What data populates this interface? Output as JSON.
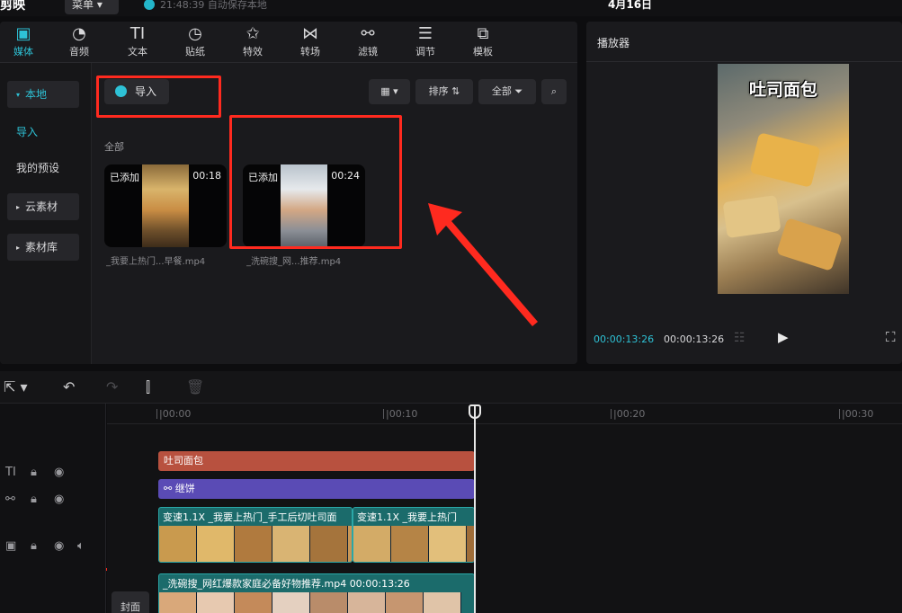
{
  "app": {
    "title": "剪映",
    "menu_label": "菜单",
    "save_status": "21:48:39 自动保存本地",
    "project_date": "4月16日"
  },
  "tabs": [
    {
      "label": "媒体",
      "icon": "media-icon",
      "glyph": "▣",
      "active": true
    },
    {
      "label": "音频",
      "icon": "audio-icon",
      "glyph": "◔"
    },
    {
      "label": "文本",
      "icon": "text-icon",
      "glyph": "TI"
    },
    {
      "label": "贴纸",
      "icon": "sticker-icon",
      "glyph": "◷"
    },
    {
      "label": "特效",
      "icon": "effects-icon",
      "glyph": "✩"
    },
    {
      "label": "转场",
      "icon": "transition-icon",
      "glyph": "⋈"
    },
    {
      "label": "滤镜",
      "icon": "filter-icon",
      "glyph": "⚯"
    },
    {
      "label": "调节",
      "icon": "adjust-icon",
      "glyph": "☰"
    },
    {
      "label": "模板",
      "icon": "template-icon",
      "glyph": "⧉"
    }
  ],
  "side_nav": {
    "local": "本地",
    "import": "导入",
    "my_presets": "我的预设",
    "cloud": "云素材",
    "library": "素材库"
  },
  "media": {
    "import_label": "导入",
    "sort_label": "排序",
    "filter_label": "全部",
    "section_label": "全部",
    "items": [
      {
        "added": "已添加",
        "duration": "00:18",
        "name": "_我要上热门...早餐.mp4"
      },
      {
        "added": "已添加",
        "duration": "00:24",
        "name": "_洗碗搜_网...推荐.mp4"
      }
    ]
  },
  "player": {
    "title": "播放器",
    "caption": "吐司面包",
    "time_current": "00:00:13:26",
    "time_total": "00:00:13:26"
  },
  "timeline": {
    "ruler": [
      "|00:00",
      "|00:10",
      "|00:20",
      "|00:30"
    ],
    "text_clip": "吐司面包",
    "effect_clip": "继饼",
    "video_clip_1": "变速1.1X  _我要上热门_手工后切吐司面",
    "video_clip_2": "变速1.1X  _我要上热门",
    "video_clip_3": "_洗碗搜_网红爆款家庭必备好物推荐.mp4  00:00:13:26",
    "cover_label": "封面"
  },
  "colors": {
    "accent": "#2ec2d6",
    "annotation": "#ff2a1f",
    "text_clip": "#b8513f",
    "effect_clip": "#5a4bb5",
    "video_clip": "#1b6b6b"
  }
}
